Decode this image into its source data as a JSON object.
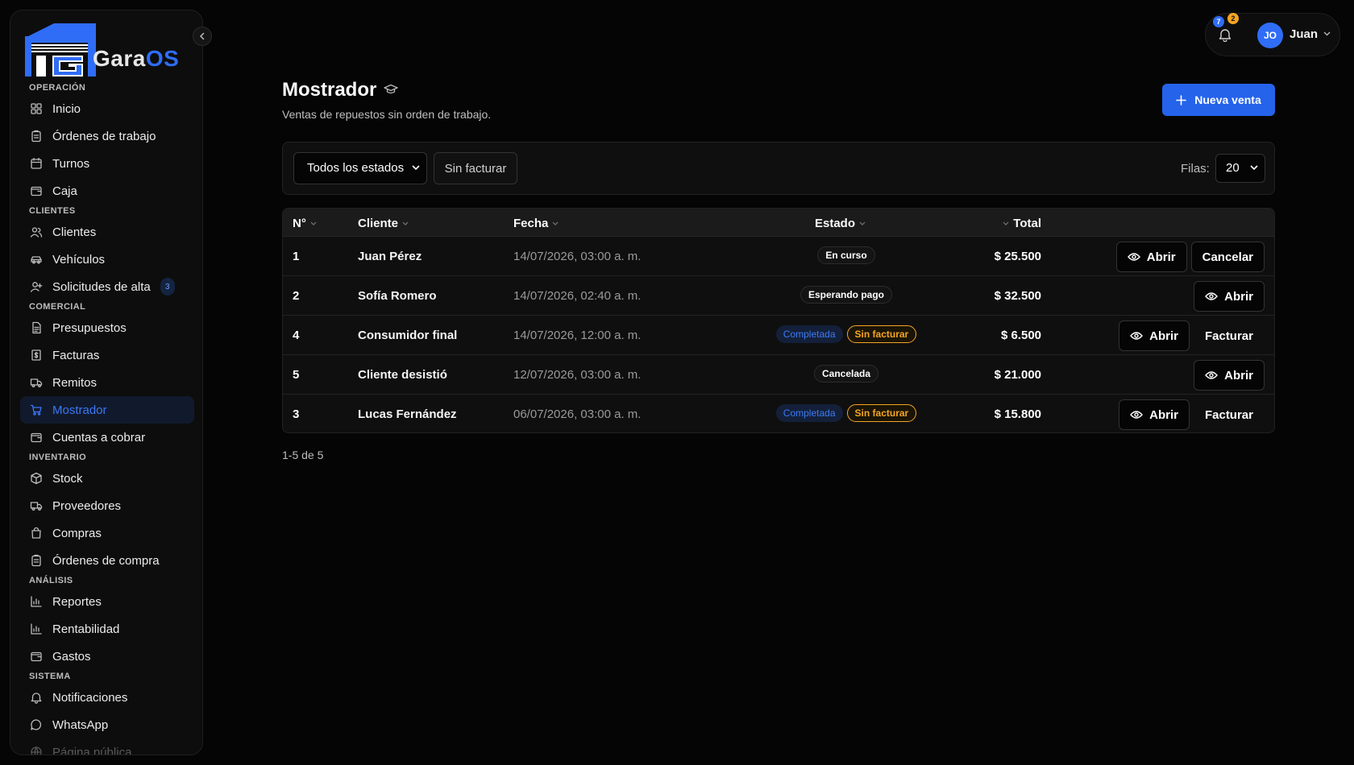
{
  "brand": {
    "name_part1": "Gara",
    "name_part2": "OS",
    "accent": "#2f6df6"
  },
  "sidebar": {
    "sections": [
      {
        "title": "OPERACIÓN",
        "items": [
          {
            "label": "Inicio",
            "icon": "grid-icon"
          },
          {
            "label": "Órdenes de trabajo",
            "icon": "clipboard-icon"
          },
          {
            "label": "Turnos",
            "icon": "calendar-icon"
          },
          {
            "label": "Caja",
            "icon": "wallet-icon"
          }
        ]
      },
      {
        "title": "CLIENTES",
        "items": [
          {
            "label": "Clientes",
            "icon": "users-icon"
          },
          {
            "label": "Vehículos",
            "icon": "car-icon"
          },
          {
            "label": "Solicitudes de alta",
            "icon": "user-plus-icon",
            "badge": "3"
          }
        ]
      },
      {
        "title": "COMERCIAL",
        "items": [
          {
            "label": "Presupuestos",
            "icon": "document-icon"
          },
          {
            "label": "Facturas",
            "icon": "receipt-icon"
          },
          {
            "label": "Remitos",
            "icon": "truck-icon"
          },
          {
            "label": "Mostrador",
            "icon": "cart-icon",
            "active": true
          },
          {
            "label": "Cuentas a cobrar",
            "icon": "wallet-icon"
          }
        ]
      },
      {
        "title": "INVENTARIO",
        "items": [
          {
            "label": "Stock",
            "icon": "box-icon"
          },
          {
            "label": "Proveedores",
            "icon": "truck-icon"
          },
          {
            "label": "Compras",
            "icon": "bag-icon"
          },
          {
            "label": "Órdenes de compra",
            "icon": "clipboard-icon"
          }
        ]
      },
      {
        "title": "ANÁLISIS",
        "items": [
          {
            "label": "Reportes",
            "icon": "bar-chart-icon"
          },
          {
            "label": "Rentabilidad",
            "icon": "bar-chart-icon"
          },
          {
            "label": "Gastos",
            "icon": "wallet-icon"
          }
        ]
      },
      {
        "title": "SISTEMA",
        "items": [
          {
            "label": "Notificaciones",
            "icon": "bell-icon"
          },
          {
            "label": "WhatsApp",
            "icon": "chat-icon"
          },
          {
            "label": "Página pública",
            "icon": "globe-icon",
            "faded": true
          }
        ]
      }
    ]
  },
  "topbar": {
    "notif_count_blue": "7",
    "notif_count_orange": "2",
    "avatar_initials": "JO",
    "user_name": "Juan"
  },
  "page": {
    "title": "Mostrador",
    "subtitle": "Ventas de repuestos sin orden de trabajo.",
    "new_button": "Nueva venta"
  },
  "filters": {
    "state_select": "Todos los estados",
    "unbilled_button": "Sin facturar",
    "rows_label": "Filas:",
    "rows_value": "20"
  },
  "table": {
    "headers": {
      "num": "N°",
      "client": "Cliente",
      "date": "Fecha",
      "status": "Estado",
      "total": "Total"
    },
    "rows": [
      {
        "num": "1",
        "client": "Juan Pérez",
        "date": "14/07/2026, 03:00 a. m.",
        "status": [
          {
            "text": "En curso",
            "kind": "neutral"
          }
        ],
        "total": "$ 25.500",
        "actions": [
          {
            "text": "Abrir",
            "kind": "open"
          },
          {
            "text": "Cancelar",
            "kind": "outline"
          }
        ]
      },
      {
        "num": "2",
        "client": "Sofía Romero",
        "date": "14/07/2026, 02:40 a. m.",
        "status": [
          {
            "text": "Esperando pago",
            "kind": "neutral"
          }
        ],
        "total": "$ 32.500",
        "actions": [
          {
            "text": "Abrir",
            "kind": "open"
          }
        ]
      },
      {
        "num": "4",
        "client": "Consumidor final",
        "date": "14/07/2026, 12:00 a. m.",
        "status": [
          {
            "text": "Completada",
            "kind": "blue"
          },
          {
            "text": "Sin facturar",
            "kind": "orange"
          }
        ],
        "total": "$ 6.500",
        "actions": [
          {
            "text": "Abrir",
            "kind": "open"
          },
          {
            "text": "Facturar",
            "kind": "ghost"
          }
        ]
      },
      {
        "num": "5",
        "client": "Cliente desistió",
        "date": "12/07/2026, 03:00 a. m.",
        "status": [
          {
            "text": "Cancelada",
            "kind": "neutral"
          }
        ],
        "total": "$ 21.000",
        "actions": [
          {
            "text": "Abrir",
            "kind": "open"
          }
        ]
      },
      {
        "num": "3",
        "client": "Lucas Fernández",
        "date": "06/07/2026, 03:00 a. m.",
        "status": [
          {
            "text": "Completada",
            "kind": "blue"
          },
          {
            "text": "Sin facturar",
            "kind": "orange"
          }
        ],
        "total": "$ 15.800",
        "actions": [
          {
            "text": "Abrir",
            "kind": "open"
          },
          {
            "text": "Facturar",
            "kind": "ghost"
          }
        ]
      }
    ]
  },
  "pagination": {
    "text": "1-5 de 5"
  }
}
